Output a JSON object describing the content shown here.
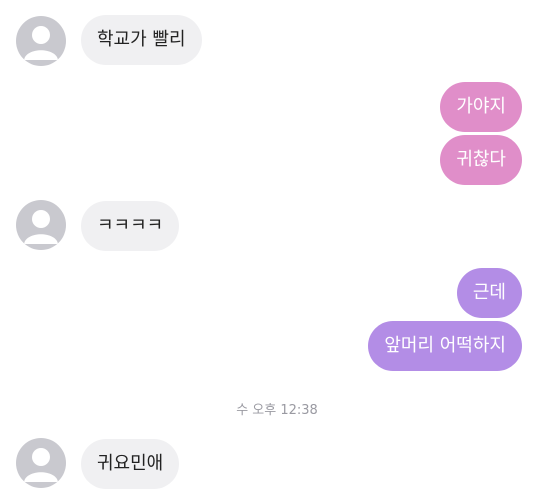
{
  "messages": [
    {
      "side": "in",
      "text": "학교가 빨리"
    },
    {
      "side": "out",
      "text": "가야지"
    },
    {
      "side": "out",
      "text": "귀찮다"
    },
    {
      "side": "in",
      "text": "ㅋㅋㅋㅋ"
    },
    {
      "side": "out",
      "text": "근데"
    },
    {
      "side": "out",
      "text": "앞머리 어떡하지"
    },
    {
      "side": "in",
      "text": "귀요민애"
    }
  ],
  "timestamp": "수 오후 12:38",
  "colors": {
    "incoming_bubble": "#f0f0f2",
    "outgoing_pink": "#e08ec9",
    "outgoing_purple": "#b38de6",
    "avatar": "#c9c9cf"
  },
  "icons": {
    "avatar": "default-profile-icon"
  }
}
